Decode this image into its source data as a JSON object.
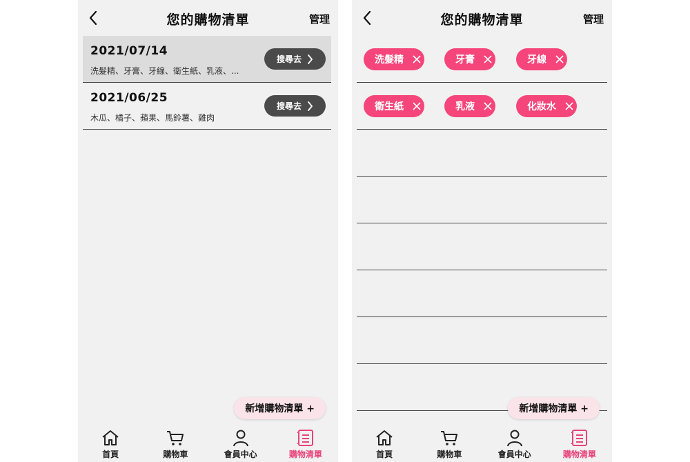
{
  "colors": {
    "accent": "#f5457a",
    "dark_button": "#4a4a4a",
    "background": "#f1f1f1"
  },
  "left": {
    "header": {
      "title": "您的購物清單",
      "manage": "管理"
    },
    "lists": [
      {
        "date": "2021/07/14",
        "items": "洗髮精、牙膏、牙線、衛生紙、乳液、...",
        "button": "搜尋去"
      },
      {
        "date": "2021/06/25",
        "items": "木瓜、橘子、蘋果、馬鈴薯、雞肉",
        "button": "搜尋去"
      }
    ],
    "add_button": "新增購物清單 +"
  },
  "right": {
    "header": {
      "title": "您的購物清單",
      "manage": "管理"
    },
    "tags": [
      "洗髮精",
      "牙膏",
      "牙線",
      "衛生紙",
      "乳液",
      "化妝水"
    ],
    "add_button": "新增購物清單 +"
  },
  "tabbar": {
    "items": [
      {
        "label": "首頁",
        "icon": "home-icon"
      },
      {
        "label": "購物車",
        "icon": "cart-icon"
      },
      {
        "label": "會員中心",
        "icon": "user-icon"
      },
      {
        "label": "購物清單",
        "icon": "list-icon",
        "active": true
      }
    ]
  }
}
